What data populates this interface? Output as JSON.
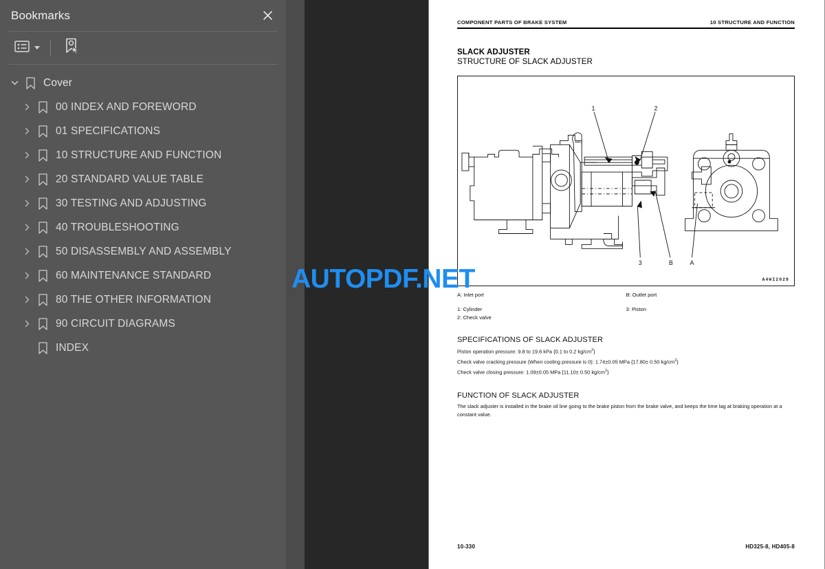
{
  "sidebar": {
    "title": "Bookmarks",
    "close_icon": "close-icon",
    "toolbar": {
      "options_label": "bookmark-options",
      "options_icon": "list-options-icon",
      "caret_icon": "chevron-down-icon",
      "find_icon": "find-bookmark-icon"
    },
    "items": [
      {
        "label": "Cover",
        "depth": 0,
        "expanded": true,
        "has_children": true
      },
      {
        "label": "00 INDEX AND FOREWORD",
        "depth": 1,
        "expanded": false,
        "has_children": true
      },
      {
        "label": "01 SPECIFICATIONS",
        "depth": 1,
        "expanded": false,
        "has_children": true
      },
      {
        "label": "10 STRUCTURE AND FUNCTION",
        "depth": 1,
        "expanded": false,
        "has_children": true
      },
      {
        "label": "20 STANDARD VALUE TABLE",
        "depth": 1,
        "expanded": false,
        "has_children": true
      },
      {
        "label": "30 TESTING AND ADJUSTING",
        "depth": 1,
        "expanded": false,
        "has_children": true
      },
      {
        "label": "40 TROUBLESHOOTING",
        "depth": 1,
        "expanded": false,
        "has_children": true
      },
      {
        "label": "50 DISASSEMBLY AND ASSEMBLY",
        "depth": 1,
        "expanded": false,
        "has_children": true
      },
      {
        "label": "60 MAINTENANCE STANDARD",
        "depth": 1,
        "expanded": false,
        "has_children": true
      },
      {
        "label": "80 THE OTHER INFORMATION",
        "depth": 1,
        "expanded": false,
        "has_children": true
      },
      {
        "label": "90 CIRCUIT DIAGRAMS",
        "depth": 1,
        "expanded": false,
        "has_children": true
      },
      {
        "label": "INDEX",
        "depth": 1,
        "expanded": false,
        "has_children": false
      }
    ]
  },
  "watermark": {
    "text": "AUTOPDF.NET",
    "color": "#1f8ef1"
  },
  "page": {
    "running_head_left": "COMPONENT PARTS OF BRAKE SYSTEM",
    "running_head_right": "10 STRUCTURE AND FUNCTION",
    "section_title": "SLACK ADJUSTER",
    "section_subtitle": "STRUCTURE OF SLACK ADJUSTER",
    "figure_code": "A4WI2029",
    "figure_callouts": [
      "1",
      "2",
      "3",
      "B",
      "A"
    ],
    "legend": {
      "ports": [
        {
          "left": "A: Inlet port",
          "right": "B: Outlet port"
        }
      ],
      "parts": [
        {
          "left": "1: Cylinder",
          "right": "3: Piston"
        },
        {
          "left": "2: Check valve",
          "right": ""
        }
      ]
    },
    "specifications_heading": "SPECIFICATIONS OF SLACK ADJUSTER",
    "specifications": [
      {
        "text_before": "Piston operation pressure:  9.8 to 19.6 kPa {0.1 to 0.2 kg/cm",
        "sup": "2",
        "text_after": "}"
      },
      {
        "text_before": "Check valve cracking pressure (When cooling pressure is 0): 1.74±0.05 MPa {17.80± 0.50 kg/cm",
        "sup": "2",
        "text_after": "}"
      },
      {
        "text_before": "Check valve closing pressure: 1.09±0.05 MPa {11.10± 0.50 kg/cm",
        "sup": "2",
        "text_after": "}"
      }
    ],
    "function_heading": "FUNCTION OF SLACK ADJUSTER",
    "function_text": "The slack adjuster is installed in the brake oil line going to the brake piston from the brake valve, and keeps the time lag at braking operation at a constant value.",
    "footer_left": "10-330",
    "footer_right": "HD325-8, HD405-8"
  }
}
